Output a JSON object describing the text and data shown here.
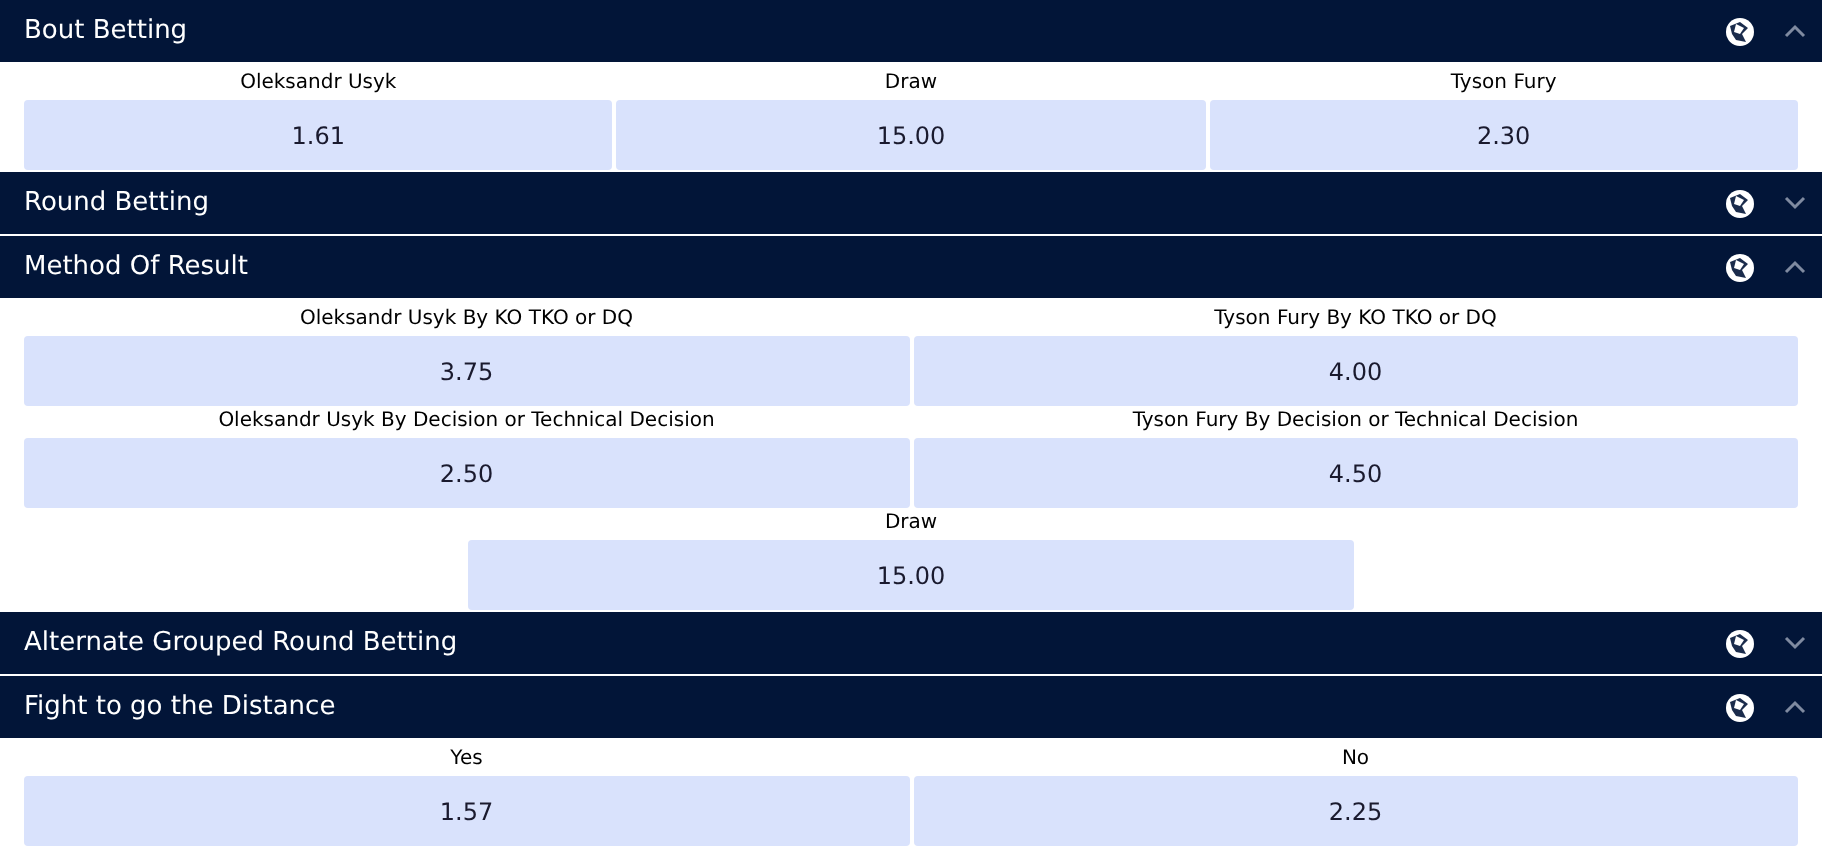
{
  "markets": [
    {
      "title": "Bout Betting",
      "expanded": true,
      "rows": [
        [
          {
            "label": "Oleksandr Usyk",
            "odds": "1.61"
          },
          {
            "label": "Draw",
            "odds": "15.00"
          },
          {
            "label": "Tyson Fury",
            "odds": "2.30"
          }
        ]
      ]
    },
    {
      "title": "Round Betting",
      "expanded": false
    },
    {
      "title": "Method Of Result",
      "expanded": true,
      "rows": [
        [
          {
            "label": "Oleksandr Usyk By KO TKO or DQ",
            "odds": "3.75"
          },
          {
            "label": "Tyson Fury By KO TKO or DQ",
            "odds": "4.00"
          }
        ],
        [
          {
            "label": "Oleksandr Usyk By Decision or Technical Decision",
            "odds": "2.50"
          },
          {
            "label": "Tyson Fury By Decision or Technical Decision",
            "odds": "4.50"
          }
        ],
        [
          {
            "label": "Draw",
            "odds": "15.00"
          }
        ]
      ]
    },
    {
      "title": "Alternate Grouped Round Betting",
      "expanded": false
    },
    {
      "title": "Fight to go the Distance",
      "expanded": true,
      "rows": [
        [
          {
            "label": "Yes",
            "odds": "1.57"
          },
          {
            "label": "No",
            "odds": "2.25"
          }
        ]
      ]
    }
  ]
}
